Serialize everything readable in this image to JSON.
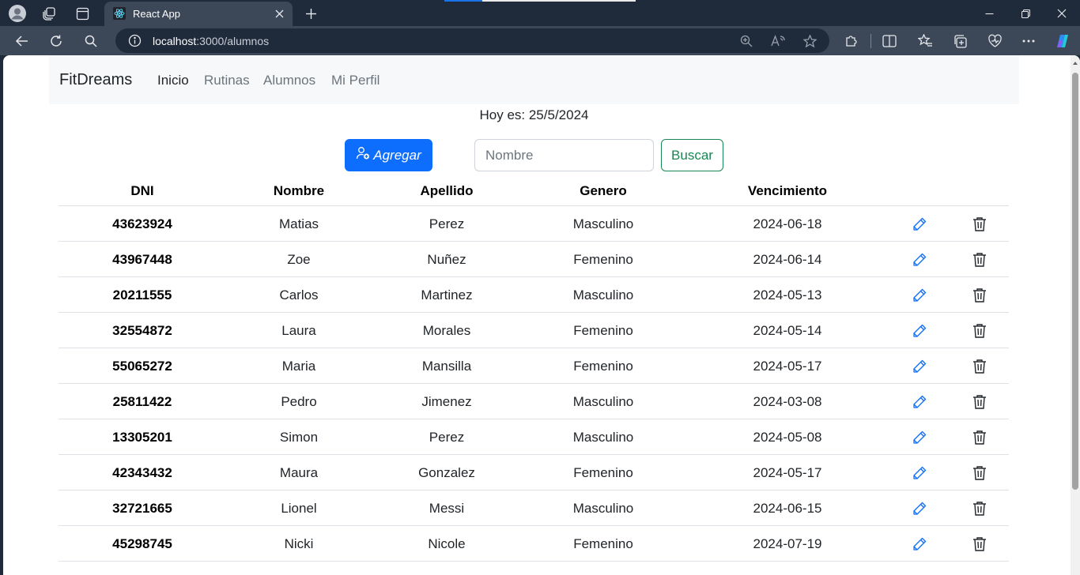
{
  "browser": {
    "tab_title": "React App",
    "url_host": "localhost",
    "url_path": ":3000/alumnos"
  },
  "navbar": {
    "brand": "FitDreams",
    "links": [
      {
        "label": "Inicio",
        "active": true
      },
      {
        "label": "Rutinas",
        "active": false
      },
      {
        "label": "Alumnos",
        "active": false
      },
      {
        "label": "Mi Perfil",
        "active": false
      }
    ]
  },
  "fecha": "Hoy es: 25/5/2024",
  "actions": {
    "agregar_label": "Agregar",
    "search_placeholder": "Nombre",
    "buscar_label": "Buscar"
  },
  "table": {
    "headers": {
      "dni": "DNI",
      "nombre": "Nombre",
      "apellido": "Apellido",
      "genero": "Genero",
      "vencimiento": "Vencimiento"
    },
    "rows": [
      {
        "dni": "43623924",
        "nombre": "Matias",
        "apellido": "Perez",
        "genero": "Masculino",
        "vencimiento": "2024-06-18"
      },
      {
        "dni": "43967448",
        "nombre": "Zoe",
        "apellido": "Nuñez",
        "genero": "Femenino",
        "vencimiento": "2024-06-14"
      },
      {
        "dni": "20211555",
        "nombre": "Carlos",
        "apellido": "Martinez",
        "genero": "Masculino",
        "vencimiento": "2024-05-13"
      },
      {
        "dni": "32554872",
        "nombre": "Laura",
        "apellido": "Morales",
        "genero": "Femenino",
        "vencimiento": "2024-05-14"
      },
      {
        "dni": "55065272",
        "nombre": "Maria",
        "apellido": "Mansilla",
        "genero": "Femenino",
        "vencimiento": "2024-05-17"
      },
      {
        "dni": "25811422",
        "nombre": "Pedro",
        "apellido": "Jimenez",
        "genero": "Masculino",
        "vencimiento": "2024-03-08"
      },
      {
        "dni": "13305201",
        "nombre": "Simon",
        "apellido": "Perez",
        "genero": "Masculino",
        "vencimiento": "2024-05-08"
      },
      {
        "dni": "42343432",
        "nombre": "Maura",
        "apellido": "Gonzalez",
        "genero": "Femenino",
        "vencimiento": "2024-05-17"
      },
      {
        "dni": "32721665",
        "nombre": "Lionel",
        "apellido": "Messi",
        "genero": "Masculino",
        "vencimiento": "2024-06-15"
      },
      {
        "dni": "45298745",
        "nombre": "Nicki",
        "apellido": "Nicole",
        "genero": "Femenino",
        "vencimiento": "2024-07-19"
      }
    ],
    "edit_icon": "pencil-icon",
    "delete_icon": "trash-icon"
  },
  "colors": {
    "primary": "#0d6efd",
    "success": "#198754",
    "edit_icon": "#0d6efd",
    "browser_frame": "#1f2a3a",
    "browser_toolbar": "#3c4758"
  }
}
